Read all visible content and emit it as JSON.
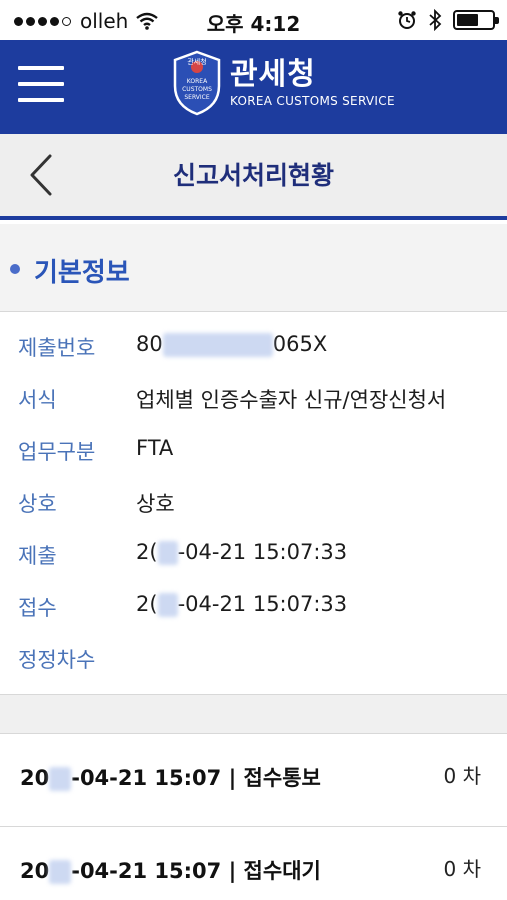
{
  "status_bar": {
    "carrier": "olleh",
    "time": "오후 4:12"
  },
  "header": {
    "menu_icon": "hamburger-menu-icon",
    "brand_ko": "관세청",
    "brand_en": "KOREA CUSTOMS SERVICE",
    "emblem_text": [
      "관세청",
      "KOREA",
      "CUSTOMS",
      "SERVICE"
    ],
    "color": "#1d3c9e"
  },
  "page": {
    "title": "신고서처리현황",
    "back_icon": "chevron-left-icon"
  },
  "section": {
    "title": "기본정보"
  },
  "info": [
    {
      "label": "제출번호",
      "value_prefix": "80",
      "value_suffix": "065X"
    },
    {
      "label": "서식",
      "value": "업체별 인증수출자 신규/연장신청서"
    },
    {
      "label": "업무구분",
      "value": "FTA"
    },
    {
      "label": "상호",
      "value": "상호"
    },
    {
      "label": "제출",
      "value_prefix": "2(",
      "value_suffix": "-04-21 15:07:33"
    },
    {
      "label": "접수",
      "value_prefix": "2(",
      "value_suffix": "-04-21 15:07:33"
    },
    {
      "label": "정정차수",
      "value": ""
    }
  ],
  "history": [
    {
      "date_prefix": "20",
      "date_suffix": "-04-21 15:07 | 접수통보",
      "count": "0 차"
    },
    {
      "date_prefix": "20",
      "date_suffix": "-04-21 15:07 | 접수대기",
      "count": "0 차"
    }
  ]
}
